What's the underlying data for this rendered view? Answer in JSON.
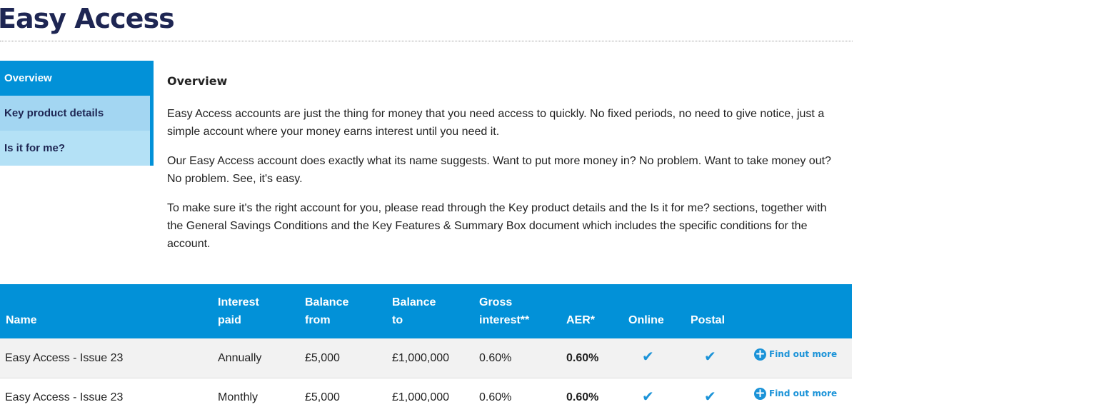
{
  "page": {
    "title": "Easy Access"
  },
  "sidebar": {
    "items": [
      {
        "label": "Overview",
        "active": true
      },
      {
        "label": "Key product details"
      },
      {
        "label": "Is it for me?"
      }
    ]
  },
  "overview": {
    "heading": "Overview",
    "paragraphs": [
      "Easy Access accounts are just the thing for money that you need access to quickly. No fixed periods, no need to give notice, just a simple account where your money earns interest until you need it.",
      "Our Easy Access account does exactly what its name suggests. Want to put more money in? No problem. Want to take money out? No problem. See, it's easy.",
      "To make sure it's the right account for you, please read through the Key product details and the Is it for me? sections, together with the General Savings Conditions and the Key Features & Summary Box document which includes the specific conditions for the account."
    ]
  },
  "rates": {
    "headers": {
      "name": "Name",
      "interest_paid": [
        "Interest",
        "paid"
      ],
      "balance_from": [
        "Balance",
        "from"
      ],
      "balance_to": [
        "Balance",
        "to"
      ],
      "gross_interest": [
        "Gross",
        "interest**"
      ],
      "aer": "AER*",
      "online": "Online",
      "postal": "Postal"
    },
    "rows": [
      {
        "name": "Easy Access - Issue 23",
        "interest_paid": "Annually",
        "balance_from": "£5,000",
        "balance_to": "£1,000,000",
        "gross": "0.60%",
        "aer": "0.60%",
        "online": "✔",
        "postal": "✔",
        "link": "Find out more"
      },
      {
        "name": "Easy Access - Issue 23",
        "interest_paid": "Monthly",
        "balance_from": "£5,000",
        "balance_to": "£1,000,000",
        "gross": "0.60%",
        "aer": "0.60%",
        "online": "✔",
        "postal": "✔",
        "link": "Find out more"
      }
    ]
  },
  "icons": {
    "tick": "check-icon",
    "find_out_more": "plus-circle-icon"
  },
  "colors": {
    "brand_navy": "#1e2653",
    "accent_blue": "#0291d8",
    "link_blue": "#1b93d8"
  }
}
